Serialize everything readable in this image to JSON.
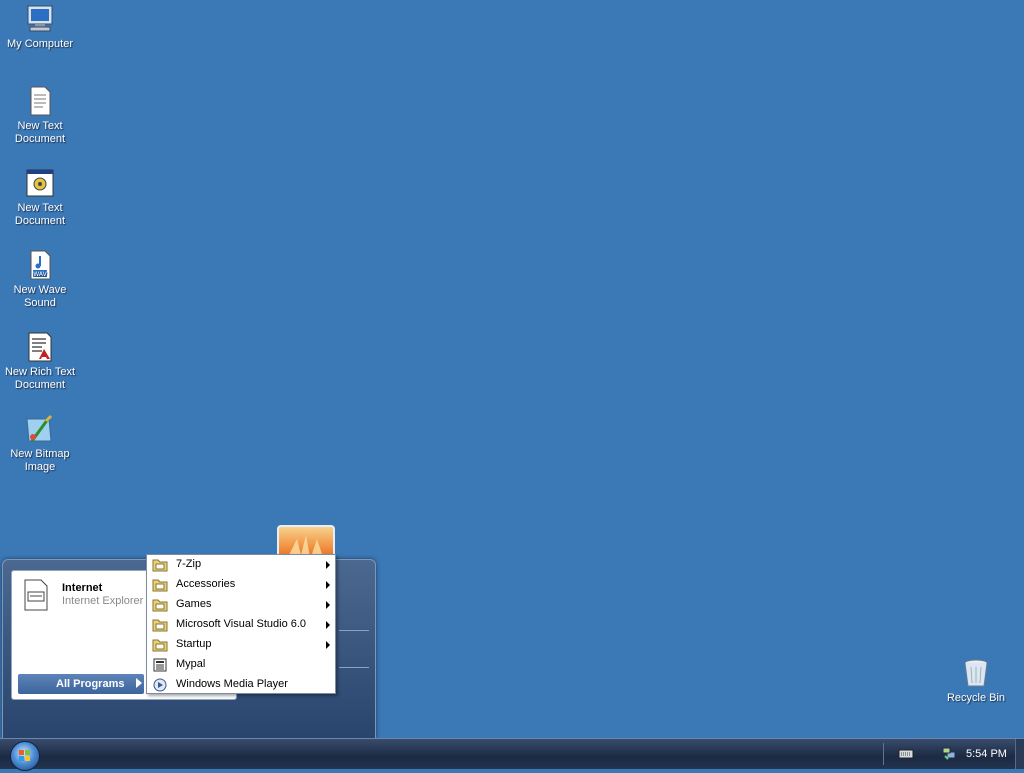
{
  "desktop": {
    "icons": [
      {
        "label": "My Computer",
        "icon": "my-computer-icon"
      },
      {
        "label": "New Text Document",
        "icon": "text-document-icon"
      },
      {
        "label": "New Text Document",
        "icon": "application-document-icon"
      },
      {
        "label": "New Wave Sound",
        "icon": "wave-sound-icon"
      },
      {
        "label": "New Rich Text Document",
        "icon": "rich-text-document-icon"
      },
      {
        "label": "New Bitmap Image",
        "icon": "bitmap-image-icon"
      },
      {
        "label": "Recycle Bin",
        "icon": "recycle-bin-icon"
      }
    ]
  },
  "start_menu": {
    "pinned": {
      "title": "Internet",
      "subtitle": "Internet Explorer",
      "icon": "internet-explorer-icon"
    },
    "all_programs": "All Programs"
  },
  "programs_menu": {
    "items": [
      {
        "label": "7-Zip",
        "icon": "folder-icon",
        "submenu": true
      },
      {
        "label": "Accessories",
        "icon": "folder-icon",
        "submenu": true
      },
      {
        "label": "Games",
        "icon": "folder-icon",
        "submenu": true
      },
      {
        "label": "Microsoft Visual Studio 6.0",
        "icon": "folder-icon",
        "submenu": true
      },
      {
        "label": "Startup",
        "icon": "folder-icon",
        "submenu": true
      },
      {
        "label": "Mypal",
        "icon": "mypal-icon",
        "submenu": false
      },
      {
        "label": "Windows Media Player",
        "icon": "media-player-icon",
        "submenu": false
      }
    ]
  },
  "taskbar": {
    "clock": "5:54 PM",
    "tray_icons": [
      "keyboard-icon",
      "network-icon"
    ]
  },
  "colors": {
    "desktop": "#3b78b6",
    "taskbar": "#1c2a42",
    "accent": "#3c659d"
  }
}
